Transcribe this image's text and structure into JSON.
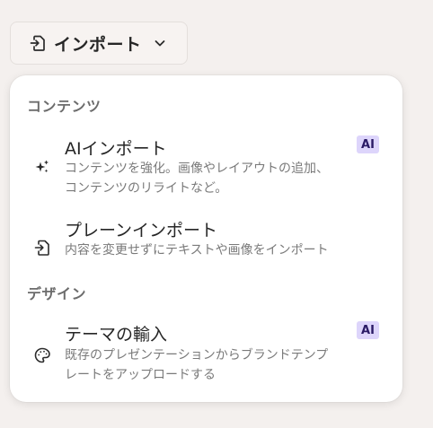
{
  "import_button": {
    "label": "インポート",
    "icon": "import-file-icon",
    "chevron": "chevron-down-icon"
  },
  "menu": {
    "sections": [
      {
        "heading": "コンテンツ",
        "items": [
          {
            "title": "AIインポート",
            "description": "コンテンツを強化。画像やレイアウトの追加、コンテンツのリライトなど。",
            "icon": "sparkles-icon",
            "badge": "AI"
          },
          {
            "title": "プレーンインポート",
            "description": "内容を変更せずにテキストや画像をインポート",
            "icon": "import-file-icon"
          }
        ]
      },
      {
        "heading": "デザイン",
        "items": [
          {
            "title": "テーマの輸入",
            "description": "既存のプレゼンテーションからブランドテンプレートをアップロードする",
            "icon": "palette-icon",
            "badge": "AI"
          }
        ]
      }
    ]
  },
  "colors": {
    "page_background": "#f4f0ee",
    "menu_background": "#ffffff",
    "ai_badge_background": "#ddd5fb",
    "ai_badge_text": "#2a1a66"
  }
}
